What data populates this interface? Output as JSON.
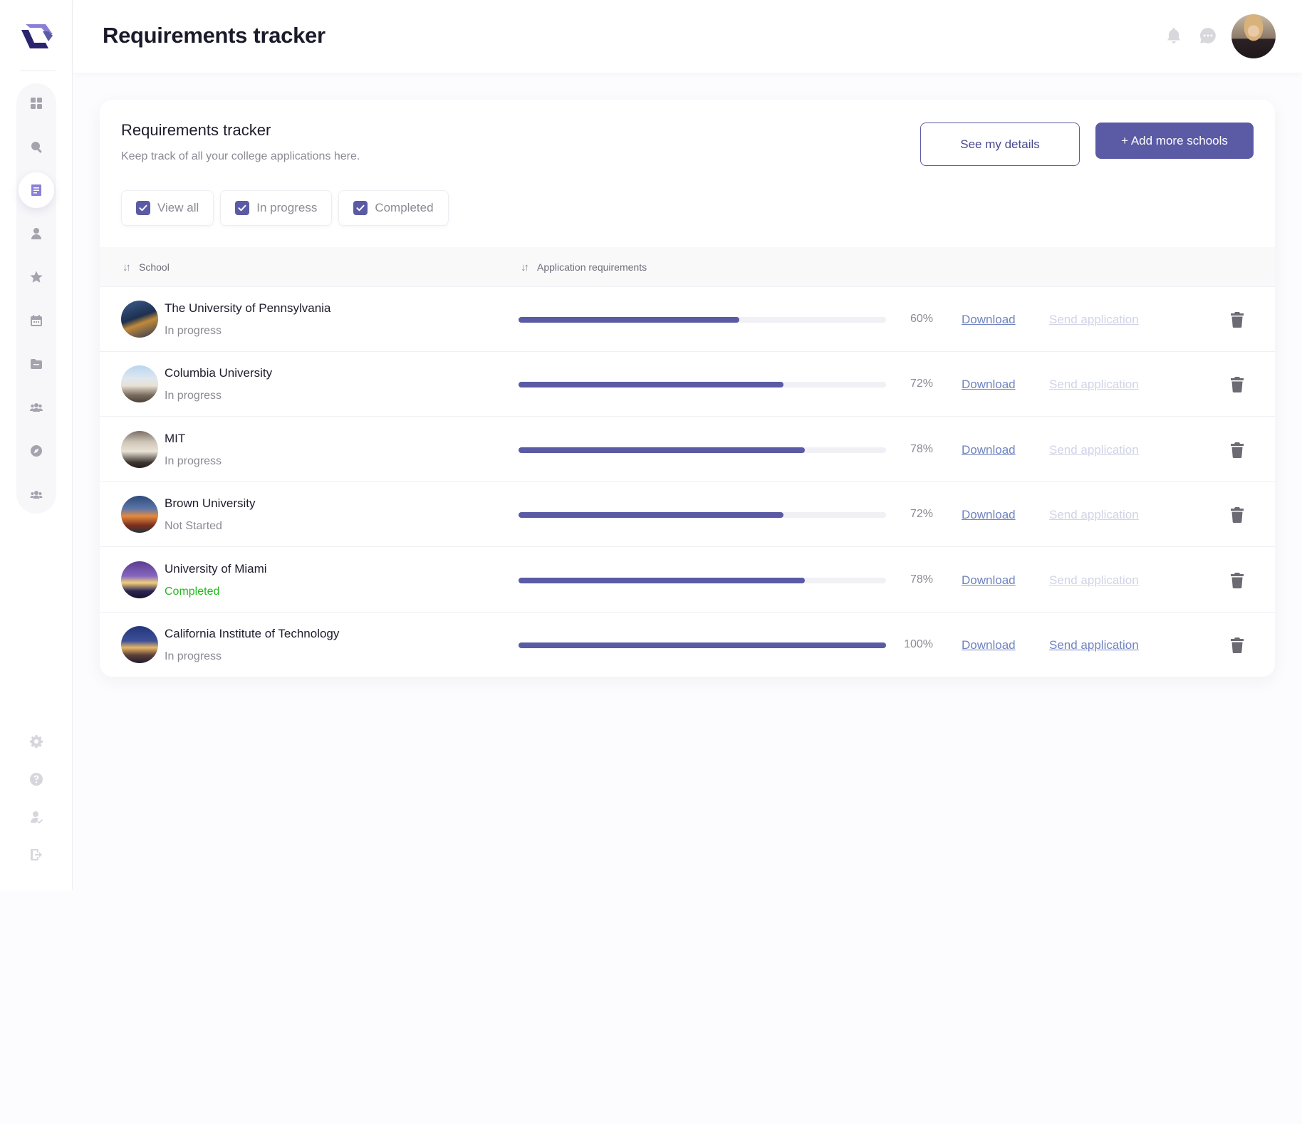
{
  "header": {
    "title": "Requirements tracker",
    "icons": [
      "bell-icon",
      "chat-icon"
    ],
    "avatar": "user-avatar"
  },
  "sidebar": {
    "items": [
      {
        "icon": "dashboard-icon",
        "active": false
      },
      {
        "icon": "search-icon",
        "active": false
      },
      {
        "icon": "document-icon",
        "active": true
      },
      {
        "icon": "user-icon",
        "active": false
      },
      {
        "icon": "star-icon",
        "active": false
      },
      {
        "icon": "calendar-icon",
        "active": false
      },
      {
        "icon": "folder-icon",
        "active": false
      },
      {
        "icon": "group-icon",
        "active": false
      },
      {
        "icon": "compass-icon",
        "active": false
      },
      {
        "icon": "community-icon",
        "active": false
      }
    ],
    "bottom_items": [
      {
        "icon": "settings-icon"
      },
      {
        "icon": "help-icon"
      },
      {
        "icon": "account-icon"
      },
      {
        "icon": "logout-icon"
      }
    ]
  },
  "card": {
    "title": "Requirements tracker",
    "subtitle": "Keep track of all your college applications here.",
    "see_details_label": "See my details",
    "add_schools_label": "+ Add more schools",
    "filters": [
      {
        "label": "View all",
        "checked": true
      },
      {
        "label": "In progress",
        "checked": true
      },
      {
        "label": "Completed",
        "checked": true
      }
    ]
  },
  "table": {
    "columns": {
      "school": "School",
      "requirements": "Application requirements"
    },
    "download_label": "Download",
    "send_label": "Send application",
    "rows": [
      {
        "name": "The University of Pennsylvania",
        "status": "In progress",
        "percent": "60%",
        "progress": 0.6,
        "send_enabled": false
      },
      {
        "name": "Columbia University",
        "status": "In progress",
        "percent": "72%",
        "progress": 0.72,
        "send_enabled": false
      },
      {
        "name": "MIT",
        "status": "In progress",
        "percent": "78%",
        "progress": 0.78,
        "send_enabled": false
      },
      {
        "name": "Brown University",
        "status": "Not Started",
        "percent": "72%",
        "progress": 0.72,
        "send_enabled": false
      },
      {
        "name": "University of Miami",
        "status": "Completed",
        "percent": "78%",
        "progress": 0.78,
        "send_enabled": false
      },
      {
        "name": "California Institute of Technology",
        "status": "In progress",
        "percent": "100%",
        "progress": 1.0,
        "send_enabled": true
      }
    ]
  },
  "colors": {
    "accent": "#5b5aa4",
    "link": "#6f83bf",
    "link_disabled": "#cfd4e6",
    "completed": "#24b71f"
  }
}
